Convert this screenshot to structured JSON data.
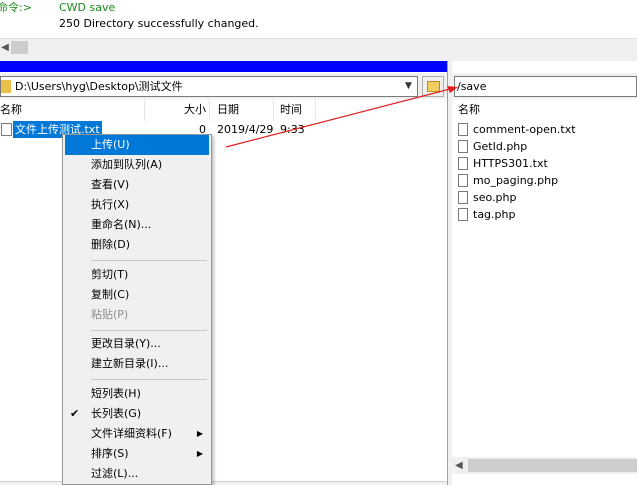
{
  "log": {
    "line1_label": "命令:>",
    "line1_msg": "CWD save",
    "line2_msg": "250 Directory successfully changed."
  },
  "local": {
    "path": "D:\\Users\\hyg\\Desktop\\测试文件",
    "columns": {
      "name": "名称",
      "size": "大小",
      "date": "日期",
      "time": "时间"
    },
    "file": {
      "name": "文件上传测试.txt",
      "size": "0",
      "date": "2019/4/29",
      "time": "9:33"
    }
  },
  "remote": {
    "path": "/save",
    "column_name": "名称",
    "files": [
      "comment-open.txt",
      "GetId.php",
      "HTTPS301.txt",
      "mo_paging.php",
      "seo.php",
      "tag.php"
    ]
  },
  "menu": {
    "upload": "上传(U)",
    "add_queue": "添加到队列(A)",
    "view": "查看(V)",
    "execute": "执行(X)",
    "rename": "重命名(N)...",
    "delete": "删除(D)",
    "cut": "剪切(T)",
    "copy": "复制(C)",
    "paste": "粘贴(P)",
    "change_dir": "更改目录(Y)...",
    "new_dir": "建立新目录(I)...",
    "short_list": "短列表(H)",
    "long_list": "长列表(G)",
    "file_details": "文件详细资料(F)",
    "sort": "排序(S)",
    "filter": "过滤(L)..."
  },
  "colors": {
    "selection": "#0078d7",
    "local_bar": "#0000ff",
    "annotation": "#e02020",
    "log_green": "#1c8a1c"
  }
}
